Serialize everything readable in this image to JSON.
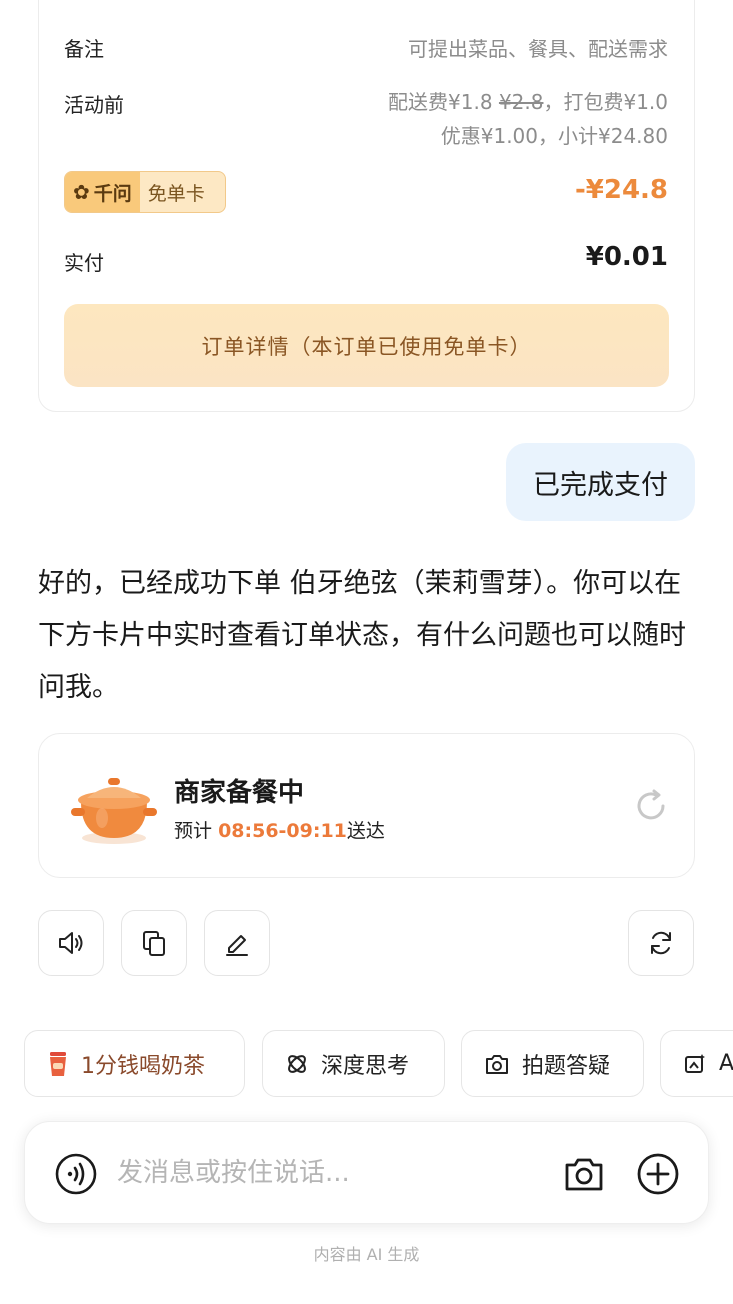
{
  "order": {
    "remark_label": "备注",
    "remark_value": "可提出菜品、餐具、配送需求",
    "pre_activity_label": "活动前",
    "delivery_fee_label": "配送费",
    "delivery_fee_value": "¥1.8",
    "delivery_fee_original": "¥2.8",
    "packing_fee_text": "，打包费¥1.0",
    "summary_text": "优惠¥1.00，小计¥24.80",
    "tag_brand": "千问",
    "tag_text": "免单卡",
    "discount": "-¥24.8",
    "paid_label": "实付",
    "paid_value": "¥0.01",
    "detail_button": "订单详情（本订单已使用免单卡）"
  },
  "user_message": "已完成支付",
  "assistant_reply": "好的，已经成功下单 伯牙绝弦（茉莉雪芽）。你可以在下方卡片中实时查看订单状态，有什么问题也可以随时问我。",
  "status_card": {
    "title": "商家备餐中",
    "eta_prefix": "预计",
    "eta_time": "08:56-09:11",
    "eta_suffix": "送达"
  },
  "chips": [
    {
      "label": "1分钱喝奶茶",
      "icon": "milk-tea-icon"
    },
    {
      "label": "深度思考",
      "icon": "deep-think-icon"
    },
    {
      "label": "拍题答疑",
      "icon": "camera-question-icon"
    },
    {
      "label": "AI",
      "icon": "ai-image-icon"
    }
  ],
  "input": {
    "placeholder": "发消息或按住说话..."
  },
  "footer_note": "内容由 AI 生成",
  "colors": {
    "accent_orange": "#ec8a3c",
    "user_bubble": "#e9f3fd",
    "detail_button_bg": "#fde7bf"
  }
}
